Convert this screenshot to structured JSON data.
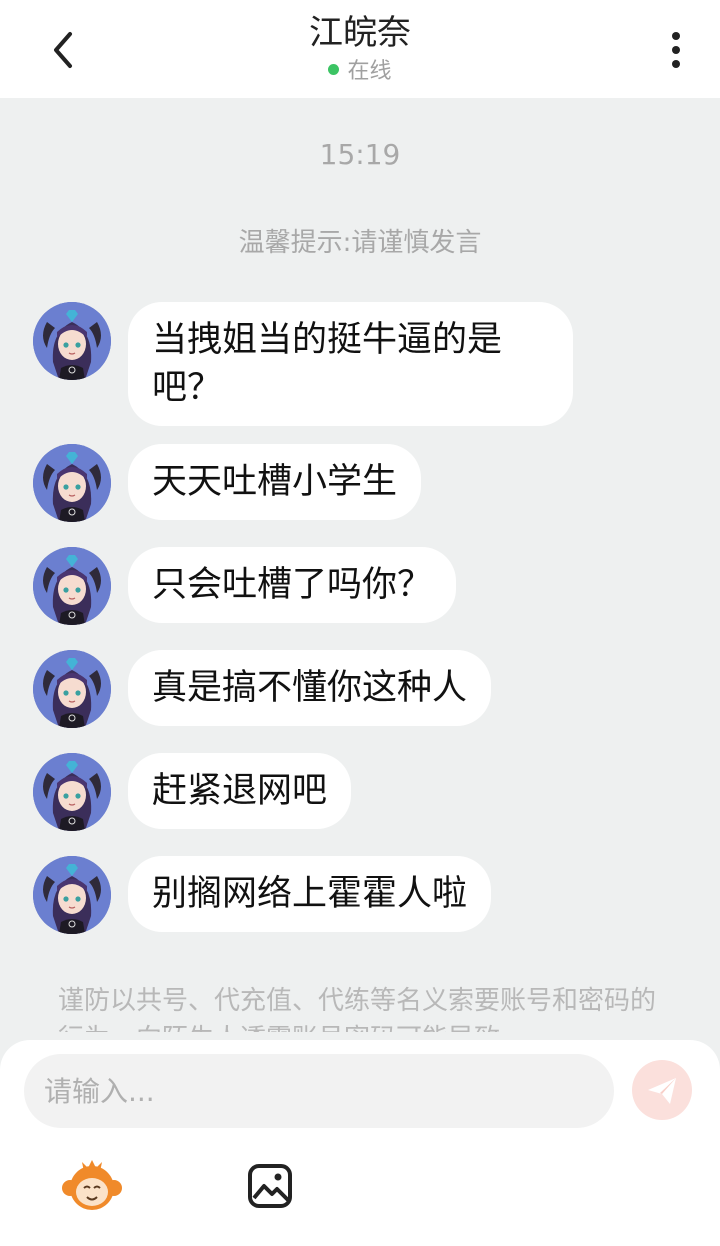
{
  "header": {
    "title": "江皖奈",
    "status": "在线"
  },
  "chat": {
    "time": "15:19",
    "tip": "温馨提示:请谨慎发言",
    "messages": [
      {
        "text": "当拽姐当的挺牛逼的是吧？"
      },
      {
        "text": "天天吐槽小学生"
      },
      {
        "text": "只会吐槽了吗你？"
      },
      {
        "text": "真是搞不懂你这种人"
      },
      {
        "text": "赶紧退网吧"
      },
      {
        "text": "别搁网络上霍霍人啦"
      }
    ],
    "warning": "谨防以共号、代充值、代练等名义索要账号和密码的行为，向陌生人透露账号密码可能导致"
  },
  "composer": {
    "placeholder": "请输入..."
  },
  "icons": {
    "back": "chevron-left-icon",
    "more": "more-vertical-icon",
    "send": "send-plane-icon",
    "emoji": "monkey-emoji-icon",
    "image": "image-icon"
  },
  "colors": {
    "online_dot": "#3cc464",
    "send_button": "#fbe0dc",
    "send_icon": "#ffffff",
    "chat_background": "#eef0f0",
    "bubble": "#ffffff",
    "emoji_orange": "#f08a2a"
  }
}
